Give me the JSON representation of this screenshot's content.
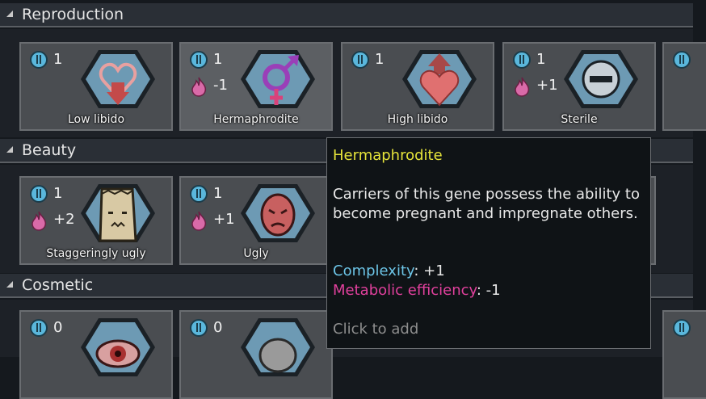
{
  "sections": [
    {
      "title": "Reproduction"
    },
    {
      "title": "Beauty"
    },
    {
      "title": "Cosmetic"
    }
  ],
  "reproduction": [
    {
      "name": "Low libido",
      "complexity": "1",
      "metabolism": ""
    },
    {
      "name": "Hermaphrodite",
      "complexity": "1",
      "metabolism": "-1"
    },
    {
      "name": "High libido",
      "complexity": "1",
      "metabolism": ""
    },
    {
      "name": "Sterile",
      "complexity": "1",
      "metabolism": "+1"
    }
  ],
  "beauty": [
    {
      "name": "Staggeringly ugly",
      "complexity": "1",
      "metabolism": "+2"
    },
    {
      "name": "Ugly",
      "complexity": "1",
      "metabolism": "+1"
    }
  ],
  "cosmetic": [
    {
      "complexity": "0"
    },
    {
      "complexity": "0"
    }
  ],
  "tooltip": {
    "title": "Hermaphrodite",
    "description": "Carriers of this gene possess the ability to become pregnant and impregnate others.",
    "complexity_label": "Complexity",
    "complexity_value": ": +1",
    "metabolic_label": "Metabolic efficiency",
    "metabolic_value": ": -1",
    "action": "Click to add"
  },
  "icons": {
    "complexity": "complexity-icon",
    "metabolism": "metabolism-icon"
  },
  "colors": {
    "tooltip_title": "#e6e43a",
    "complexity": "#6cc4e6",
    "metabolic": "#e0409c",
    "hex_fill": "#6d9ab4"
  }
}
